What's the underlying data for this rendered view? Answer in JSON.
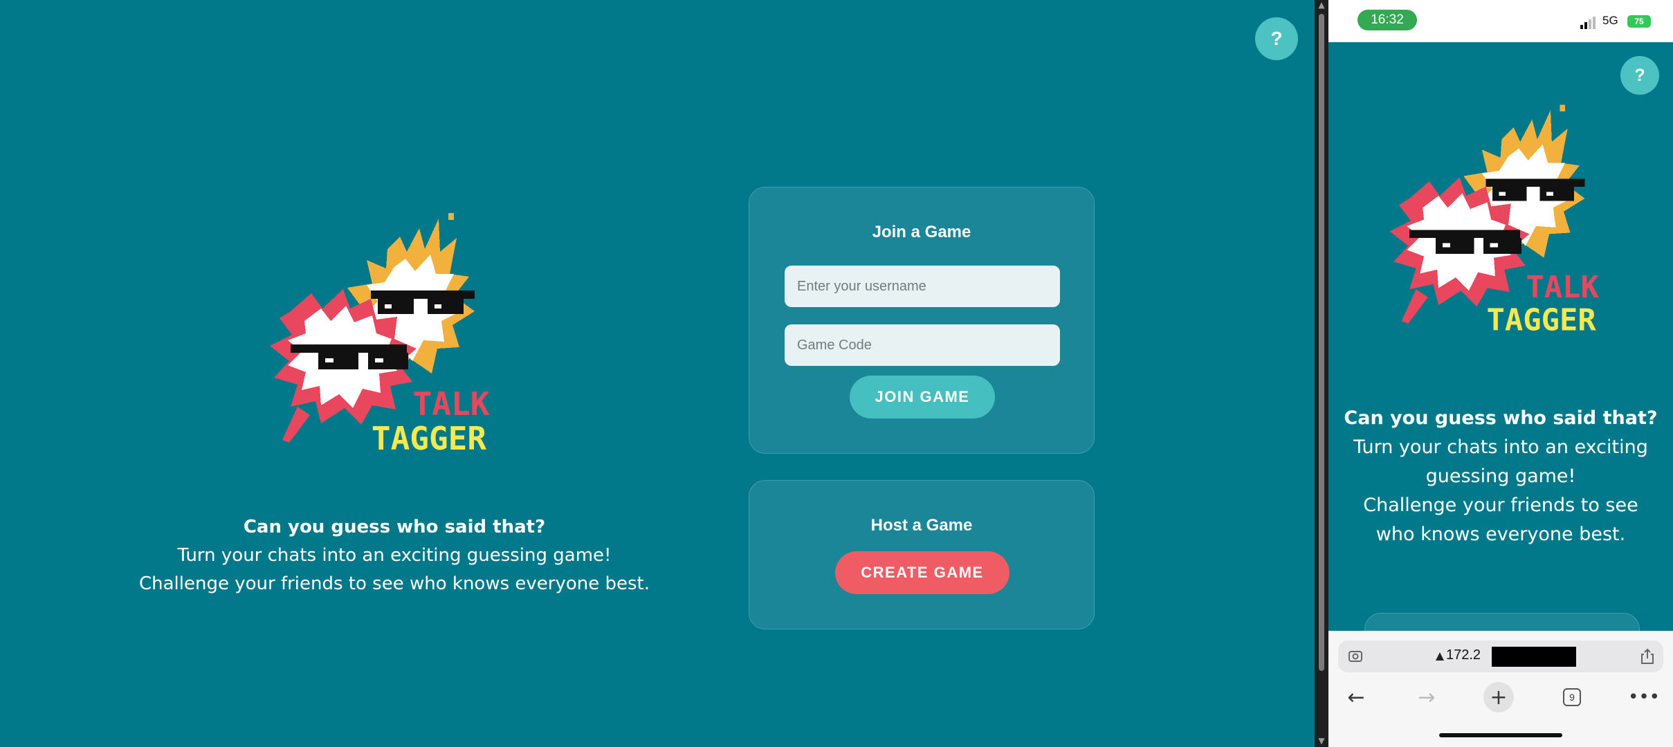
{
  "colors": {
    "background": "#02798b",
    "panel": "#1a8697",
    "join_button": "#45bfbf",
    "create_button": "#f05c63",
    "logo_red": "#e8475d",
    "logo_yellow": "#f6e94f",
    "logo_orange": "#f2b13c"
  },
  "help": {
    "label": "?"
  },
  "logo": {
    "line1": "TALK",
    "line2": "TAGGER"
  },
  "tagline": {
    "headline": "Can you guess who said that?",
    "line1": "Turn your chats into an exciting guessing game!",
    "line2": "Challenge your friends to see who knows everyone best."
  },
  "join": {
    "title": "Join a Game",
    "username_placeholder": "Enter your username",
    "code_placeholder": "Game Code",
    "button": "JOIN GAME"
  },
  "host": {
    "title": "Host a Game",
    "button": "CREATE GAME"
  },
  "phone": {
    "time": "16:32",
    "network": "5G",
    "battery": "75",
    "url": "172.2",
    "tabs_count": "9",
    "tagline": {
      "headline": "Can you guess who said that?",
      "line1": "Turn your chats into an exciting guessing game!",
      "line2": "Challenge your friends to see who knows everyone best."
    }
  },
  "icons": [
    "help-icon",
    "lens-icon",
    "share-icon",
    "back-icon",
    "forward-icon",
    "new-tab-icon",
    "tabs-icon",
    "more-icon",
    "warning-icon",
    "signal-icon",
    "battery-icon"
  ]
}
